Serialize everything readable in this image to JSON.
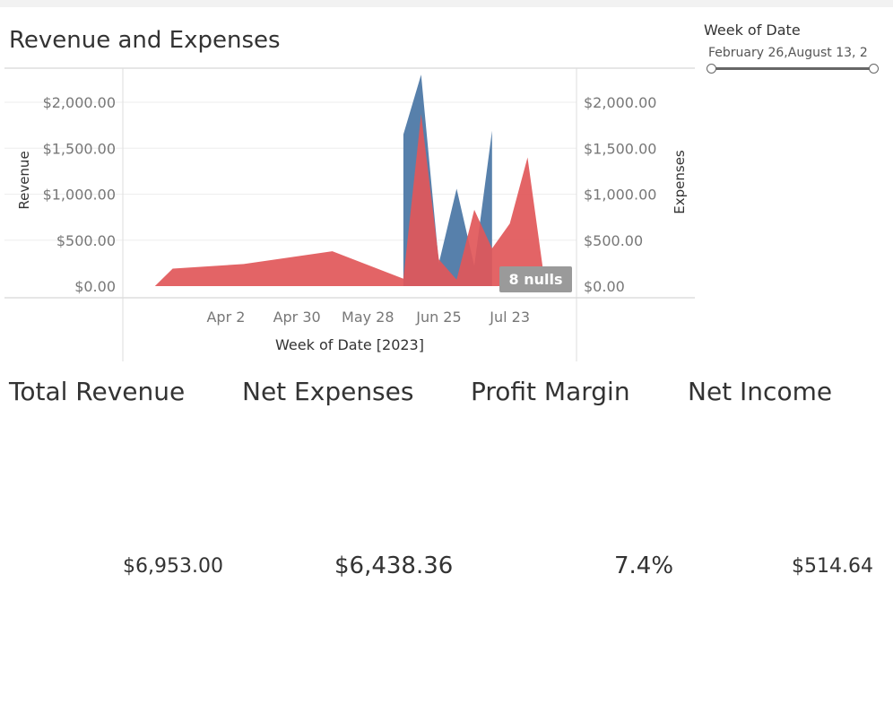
{
  "dashboard": {
    "title": "Revenue and Expenses"
  },
  "filter": {
    "title": "Week of Date",
    "range_text": "February 26,August 13, 2"
  },
  "colors": {
    "revenue": "#4e79a7",
    "expenses": "#e15759"
  },
  "chart_data": {
    "type": "area",
    "title": "Revenue and Expenses",
    "xlabel": "Week of Date [2023]",
    "x_ticks": [
      "Apr 2",
      "Apr 30",
      "May 28",
      "Jun 25",
      "Jul 23"
    ],
    "x_range": [
      "2023-02-26",
      "2023-08-13"
    ],
    "y_left_label": "Revenue",
    "y_right_label": "Expenses",
    "y_ticks": [
      "$0.00",
      "$500.00",
      "$1,000.00",
      "$1,500.00",
      "$2,000.00"
    ],
    "ylim": [
      0,
      2000
    ],
    "null_indicator": "8 nulls",
    "series": [
      {
        "name": "Revenue",
        "axis": "left",
        "points": [
          {
            "x": "2023-06-11",
            "y": 0
          },
          {
            "x": "2023-06-11",
            "y": 1650
          },
          {
            "x": "2023-06-18",
            "y": 2300
          },
          {
            "x": "2023-06-25",
            "y": 250
          },
          {
            "x": "2023-07-02",
            "y": 1060
          },
          {
            "x": "2023-07-09",
            "y": 220
          },
          {
            "x": "2023-07-16",
            "y": 1690
          },
          {
            "x": "2023-07-16",
            "y": 0
          }
        ]
      },
      {
        "name": "Expenses",
        "axis": "right",
        "points": [
          {
            "x": "2023-03-05",
            "y": 0
          },
          {
            "x": "2023-03-12",
            "y": 190
          },
          {
            "x": "2023-04-09",
            "y": 240
          },
          {
            "x": "2023-05-14",
            "y": 380
          },
          {
            "x": "2023-06-11",
            "y": 80
          },
          {
            "x": "2023-06-18",
            "y": 1870
          },
          {
            "x": "2023-06-25",
            "y": 290
          },
          {
            "x": "2023-07-02",
            "y": 70
          },
          {
            "x": "2023-07-09",
            "y": 830
          },
          {
            "x": "2023-07-16",
            "y": 410
          },
          {
            "x": "2023-07-23",
            "y": 680
          },
          {
            "x": "2023-07-30",
            "y": 1400
          },
          {
            "x": "2023-08-06",
            "y": 0
          }
        ]
      }
    ]
  },
  "kpis": [
    {
      "title": "Total Revenue",
      "value": "$6,953.00"
    },
    {
      "title": "Net Expenses",
      "value": "$6,438.36"
    },
    {
      "title": "Profit Margin",
      "value": "7.4%"
    },
    {
      "title": "Net Income",
      "value": "$514.64"
    }
  ]
}
